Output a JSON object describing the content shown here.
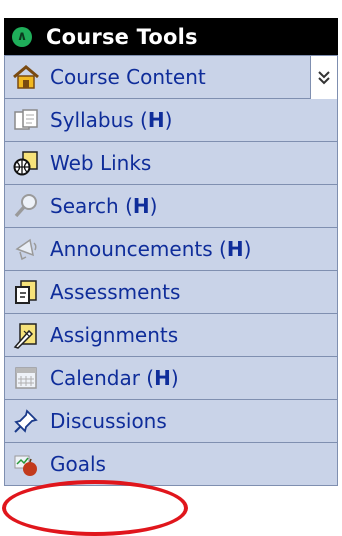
{
  "header": {
    "title": "Course Tools",
    "collapse_icon": "chevron-double-up-icon"
  },
  "menu": {
    "collapse_icon": "chevron-double-down-icon",
    "items": [
      {
        "label": "Course Content",
        "suffix": "",
        "icon": "house-icon"
      },
      {
        "label": "Syllabus (",
        "suffix": "H",
        "close": ")",
        "icon": "syllabus-icon"
      },
      {
        "label": "Web Links",
        "suffix": "",
        "icon": "globe-page-icon"
      },
      {
        "label": "Search (",
        "suffix": "H",
        "close": ")",
        "icon": "magnifier-icon"
      },
      {
        "label": "Announcements (",
        "suffix": "H",
        "close": ")",
        "icon": "megaphone-icon"
      },
      {
        "label": "Assessments",
        "suffix": "",
        "icon": "assessment-icon"
      },
      {
        "label": "Assignments",
        "suffix": "",
        "icon": "assignment-icon"
      },
      {
        "label": "Calendar (",
        "suffix": "H",
        "close": ")",
        "icon": "calendar-icon"
      },
      {
        "label": "Discussions",
        "suffix": "",
        "icon": "pushpin-icon"
      },
      {
        "label": "Goals",
        "suffix": "",
        "icon": "apple-icon"
      }
    ]
  },
  "colors": {
    "header_bg": "#000000",
    "item_bg": "#c9d3e8",
    "link": "#0f2d9a",
    "highlight": "#e0161c"
  }
}
